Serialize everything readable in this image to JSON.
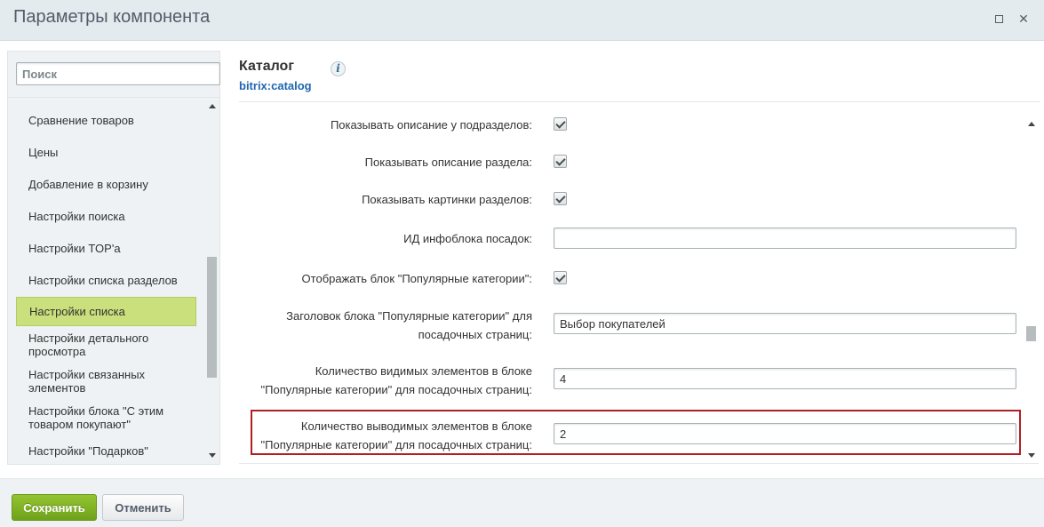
{
  "window": {
    "title": "Параметры компонента"
  },
  "sidebar": {
    "search_placeholder": "Поиск",
    "items": [
      {
        "label": "Сравнение товаров"
      },
      {
        "label": "Цены"
      },
      {
        "label": "Добавление в корзину"
      },
      {
        "label": "Настройки поиска"
      },
      {
        "label": "Настройки TOP'а"
      },
      {
        "label": "Настройки списка разделов"
      },
      {
        "label": "Настройки списка"
      },
      {
        "label": "Настройки детального просмотра"
      },
      {
        "label": "Настройки связанных элементов"
      },
      {
        "label": "Настройки блока \"С этим товаром покупают\""
      },
      {
        "label": "Настройки \"Подарков\""
      }
    ],
    "active_item": "Настройки списка"
  },
  "component": {
    "title": "Каталог",
    "code": "bitrix:catalog",
    "info_icon": "info-icon"
  },
  "settings": {
    "show_subsection_desc": {
      "label": "Показывать описание у подразделов:",
      "checked": true
    },
    "show_section_desc": {
      "label": "Показывать описание раздела:",
      "checked": true
    },
    "show_section_pictures": {
      "label": "Показывать картинки разделов:",
      "checked": true
    },
    "landing_iblock_id": {
      "label": "ИД инфоблока посадок:",
      "value": ""
    },
    "show_popular_block": {
      "label": "Отображать блок \"Популярные категории\":",
      "checked": true
    },
    "popular_header": {
      "label_line1": "Заголовок блока \"Популярные категории\" для",
      "label_line2": "посадочных страниц:",
      "value": "Выбор покупателей"
    },
    "popular_visible_count": {
      "label_line1": "Количество видимых элементов в блоке",
      "label_line2": "\"Популярные категории\" для посадочных страниц:",
      "value": "4"
    },
    "popular_output_count": {
      "label_line1": "Количество выводимых элементов в блоке",
      "label_line2": "\"Популярные категории\" для посадочных страниц:",
      "value": "2"
    }
  },
  "footer": {
    "save_label": "Сохранить",
    "cancel_label": "Отменить"
  },
  "colors": {
    "save_button": "#7db024",
    "active_nav": "#c9e07c",
    "highlight_border": "#b01f24",
    "component_code": "#2067b0"
  }
}
